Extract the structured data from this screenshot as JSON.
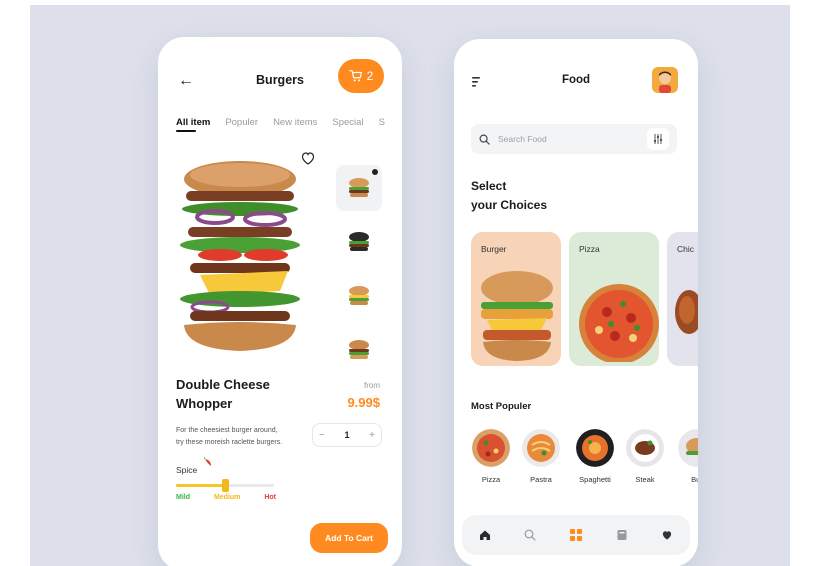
{
  "colors": {
    "accent": "#ff8a1f",
    "background": "#dde0ea",
    "mild": "#39b54a",
    "medium": "#f5b81c",
    "hot": "#e23b3b"
  },
  "left_screen": {
    "title": "Burgers",
    "cart_count": "2",
    "tabs": [
      {
        "label": "All item",
        "active": true
      },
      {
        "label": "Populer",
        "active": false
      },
      {
        "label": "New items",
        "active": false
      },
      {
        "label": "Special",
        "active": false
      },
      {
        "label": "S",
        "active": false
      }
    ],
    "product": {
      "name_line1": "Double Cheese",
      "name_line2": "Whopper",
      "from_label": "from",
      "price": "9.99$",
      "description_line1": "For the cheesiest burger around,",
      "description_line2": "try these moreish raclette burgers.",
      "quantity": "1",
      "minus": "−",
      "plus": "+"
    },
    "spice": {
      "label": "Spice",
      "level_percent": 50,
      "levels": [
        "Mild",
        "Medium",
        "Hot"
      ]
    },
    "add_to_cart_label": "Add To Cart",
    "icons": [
      "back-arrow-icon",
      "cart-icon",
      "heart-icon",
      "chili-icon"
    ]
  },
  "right_screen": {
    "title": "Food",
    "search_placeholder": "Search Food",
    "select_line1": "Select",
    "select_line2": "your Choices",
    "choices": [
      "Burger",
      "Pizza",
      "Chic"
    ],
    "most_popular_title": "Most Populer",
    "popular": [
      "Pizza",
      "Pastra",
      "Spaghetti",
      "Steak",
      "Bur"
    ],
    "nav": [
      "home-icon",
      "search-icon",
      "grid-icon",
      "bag-icon",
      "heart-icon"
    ]
  }
}
